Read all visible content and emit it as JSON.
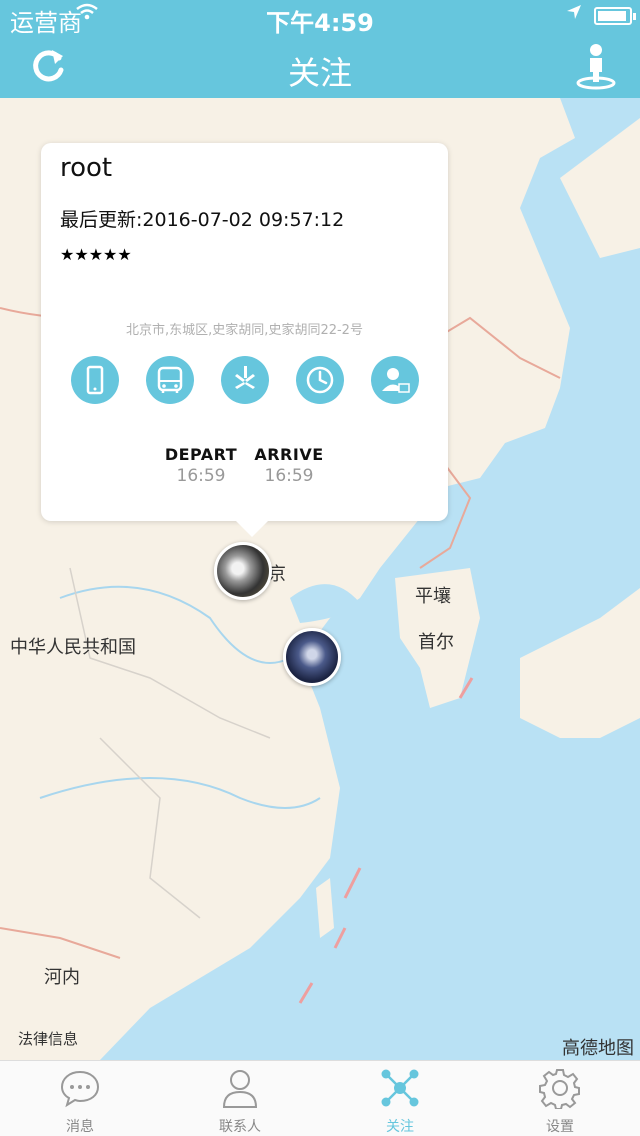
{
  "status_bar": {
    "carrier": "运营商",
    "time": "下午4:59",
    "wifi_icon": "wifi-icon",
    "location_icon": "location-arrow-icon",
    "battery_icon": "battery-icon"
  },
  "nav_bar": {
    "title": "关注",
    "left_icon": "refresh-icon",
    "right_icon": "person-location-icon"
  },
  "map": {
    "labels": {
      "pyongyang": "平壤",
      "seoul": "首尔",
      "china": "中华人民共和国",
      "hanoi": "河内",
      "beijing_fragment": "京",
      "bottom_left": "法律信息"
    },
    "credit": "高德地图",
    "colors": {
      "sea": "#b9e1f4",
      "land": "#f7f1e6",
      "border": "#e8a99a"
    }
  },
  "popup": {
    "name": "root",
    "last_update": "最后更新:2016-07-02 09:57:12",
    "rating": 5,
    "stars": "★★★★★",
    "address": "北京市,东城区,史家胡同,史家胡同22-2号",
    "actions": [
      {
        "icon": "phone-icon"
      },
      {
        "icon": "bus-icon"
      },
      {
        "icon": "yelp-icon"
      },
      {
        "icon": "clock-icon"
      },
      {
        "icon": "contact-card-icon"
      }
    ],
    "depart_label": "DEPART",
    "depart_time": "16:59",
    "arrive_label": "ARRIVE",
    "arrive_time": "16:59"
  },
  "tabs": [
    {
      "label": "消息",
      "icon": "chat-bubble-icon",
      "active": false
    },
    {
      "label": "联系人",
      "icon": "person-icon",
      "active": false
    },
    {
      "label": "关注",
      "icon": "network-icon",
      "active": true
    },
    {
      "label": "设置",
      "icon": "gear-icon",
      "active": false
    }
  ],
  "accent_color": "#66c6dd"
}
